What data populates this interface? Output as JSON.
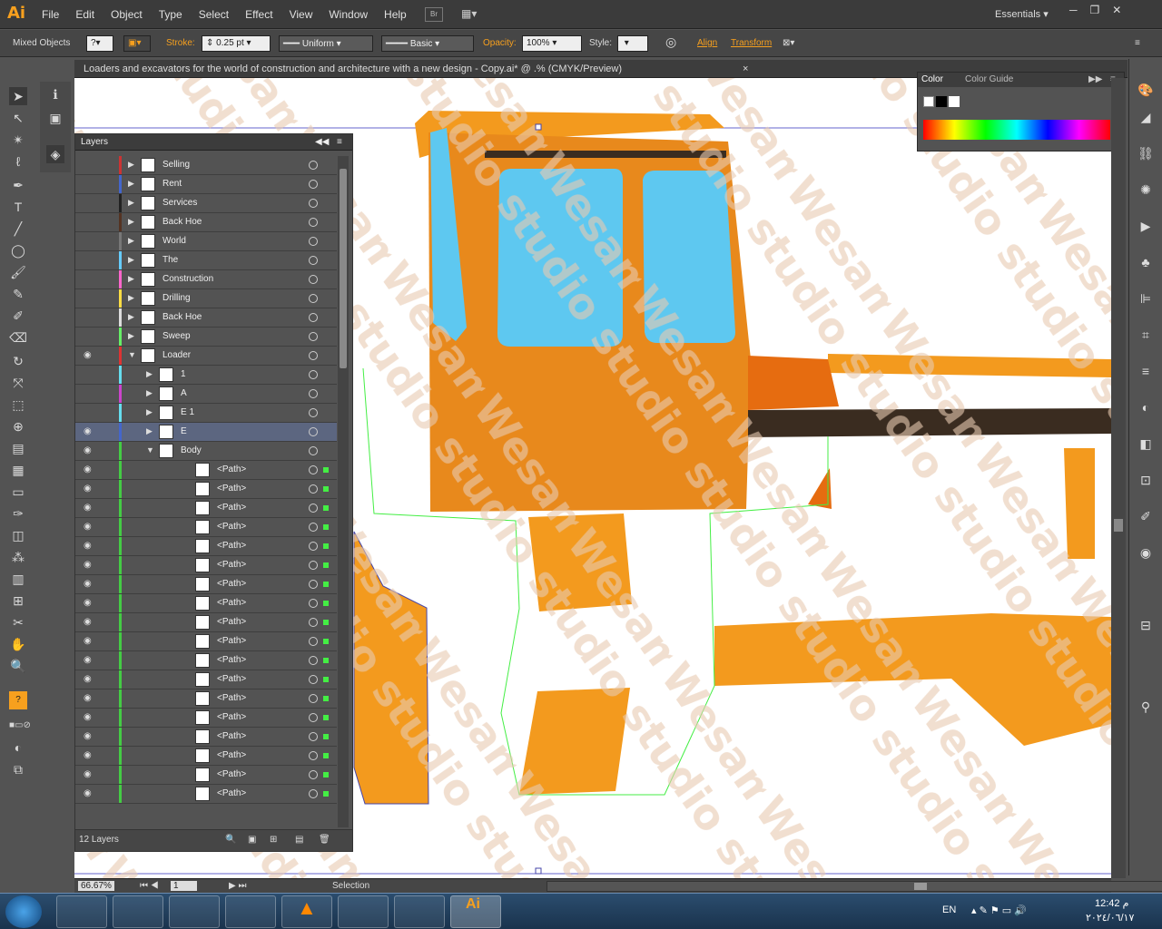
{
  "app": {
    "logo": "Ai",
    "brand_color": "#f7a01e"
  },
  "menu": [
    "File",
    "Edit",
    "Object",
    "Type",
    "Select",
    "Effect",
    "View",
    "Window",
    "Help"
  ],
  "menu_extra": {
    "br": "Br",
    "workspace": "Essentials"
  },
  "control_bar": {
    "selection_type": "Mixed Objects",
    "stroke_label": "Stroke:",
    "stroke_value": "0.25 pt",
    "profile": "Uniform",
    "brush": "Basic",
    "opacity_label": "Opacity:",
    "opacity_value": "100%",
    "style_label": "Style:",
    "align": "Align",
    "transform": "Transform"
  },
  "document_tab": {
    "title": "Loaders and excavators for the world of construction and architecture with a new design - Copy.ai* @ .% (CMYK/Preview)",
    "close": "×"
  },
  "layers_panel": {
    "title": "Layers",
    "count_label": "12 Layers",
    "rows": [
      {
        "name": "Selling",
        "color": "#cc3333",
        "level": 0,
        "expanded": false,
        "visible": false
      },
      {
        "name": "Rent",
        "color": "#4466cc",
        "level": 0,
        "expanded": false,
        "visible": false
      },
      {
        "name": "Services",
        "color": "#222222",
        "level": 0,
        "expanded": false,
        "visible": false
      },
      {
        "name": "Back Hoe",
        "color": "#553322",
        "level": 0,
        "expanded": false,
        "visible": false
      },
      {
        "name": "World",
        "color": "#777777",
        "level": 0,
        "expanded": false,
        "visible": false
      },
      {
        "name": "The",
        "color": "#66ccff",
        "level": 0,
        "expanded": false,
        "visible": false
      },
      {
        "name": "Construction",
        "color": "#ff66cc",
        "level": 0,
        "expanded": false,
        "visible": false
      },
      {
        "name": "Drilling",
        "color": "#ffdd44",
        "level": 0,
        "expanded": false,
        "visible": false
      },
      {
        "name": "Back Hoe",
        "color": "#dddddd",
        "level": 0,
        "expanded": false,
        "visible": false
      },
      {
        "name": "Sweep",
        "color": "#66ee66",
        "level": 0,
        "expanded": false,
        "visible": false
      },
      {
        "name": "Loader",
        "color": "#dd3333",
        "level": 0,
        "expanded": true,
        "visible": true
      },
      {
        "name": "1",
        "color": "#66ddee",
        "level": 1,
        "expanded": false,
        "visible": false
      },
      {
        "name": "A",
        "color": "#cc44cc",
        "level": 1,
        "expanded": false,
        "visible": false
      },
      {
        "name": "E 1",
        "color": "#66ddee",
        "level": 1,
        "expanded": false,
        "visible": false
      },
      {
        "name": "E",
        "color": "#4466cc",
        "level": 1,
        "expanded": false,
        "visible": true,
        "selected": true
      },
      {
        "name": "Body",
        "color": "#44cc44",
        "level": 1,
        "expanded": true,
        "visible": true
      },
      {
        "name": "<Path>",
        "color": "#44cc44",
        "level": 2,
        "visible": true
      },
      {
        "name": "<Path>",
        "color": "#44cc44",
        "level": 2,
        "visible": true
      },
      {
        "name": "<Path>",
        "color": "#44cc44",
        "level": 2,
        "visible": true
      },
      {
        "name": "<Path>",
        "color": "#44cc44",
        "level": 2,
        "visible": true
      },
      {
        "name": "<Path>",
        "color": "#44cc44",
        "level": 2,
        "visible": true
      },
      {
        "name": "<Path>",
        "color": "#44cc44",
        "level": 2,
        "visible": true
      },
      {
        "name": "<Path>",
        "color": "#44cc44",
        "level": 2,
        "visible": true
      },
      {
        "name": "<Path>",
        "color": "#44cc44",
        "level": 2,
        "visible": true
      },
      {
        "name": "<Path>",
        "color": "#44cc44",
        "level": 2,
        "visible": true
      },
      {
        "name": "<Path>",
        "color": "#44cc44",
        "level": 2,
        "visible": true
      },
      {
        "name": "<Path>",
        "color": "#44cc44",
        "level": 2,
        "visible": true
      },
      {
        "name": "<Path>",
        "color": "#44cc44",
        "level": 2,
        "visible": true
      },
      {
        "name": "<Path>",
        "color": "#44cc44",
        "level": 2,
        "visible": true
      },
      {
        "name": "<Path>",
        "color": "#44cc44",
        "level": 2,
        "visible": true
      },
      {
        "name": "<Path>",
        "color": "#44cc44",
        "level": 2,
        "visible": true
      },
      {
        "name": "<Path>",
        "color": "#44cc44",
        "level": 2,
        "visible": true
      },
      {
        "name": "<Path>",
        "color": "#44cc44",
        "level": 2,
        "visible": true
      },
      {
        "name": "<Path>",
        "color": "#44cc44",
        "level": 2,
        "visible": true
      }
    ]
  },
  "color_panel": {
    "tab1": "Color",
    "tab2": "Color Guide"
  },
  "status": {
    "zoom": "66.67%",
    "artboard": "1",
    "tool": "Selection"
  },
  "taskbar": {
    "lang": "EN",
    "time": "12:42 م",
    "date": "٢٠٢٤/٠٦/١٧"
  },
  "watermark": "Wesam studio"
}
